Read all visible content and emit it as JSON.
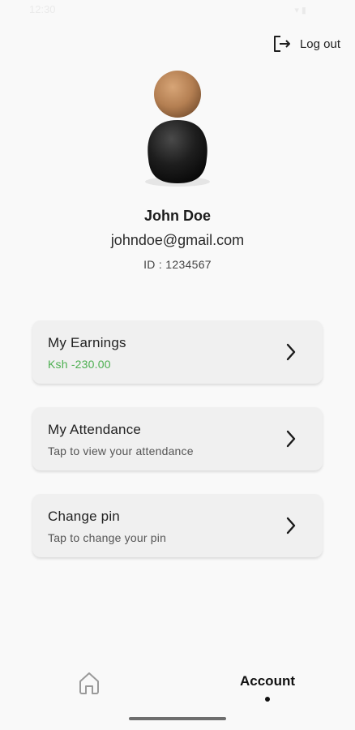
{
  "status_bar": {
    "time": "12:30",
    "icons": "▾ ▮"
  },
  "header": {
    "logout_label": "Log out",
    "logout_icon": "logout-arrow-icon"
  },
  "profile": {
    "name": "John Doe",
    "email": "johndoe@gmail.com",
    "id_text": "ID : 1234567",
    "avatar_icon": "person-avatar-icon"
  },
  "menu": [
    {
      "title": "My Earnings",
      "subtitle": "Ksh -230.00",
      "subtitle_color": "#4caf50"
    },
    {
      "title": "My Attendance",
      "subtitle": "Tap to view your attendance"
    },
    {
      "title": "Change pin",
      "subtitle": "Tap to change your pin"
    }
  ],
  "bottom_nav": {
    "home_icon": "home-icon",
    "account_label": "Account",
    "active_tab": "Account"
  },
  "colors": {
    "background": "#f9f9f9",
    "card": "#f0f0f0",
    "accent_green": "#4caf50"
  }
}
